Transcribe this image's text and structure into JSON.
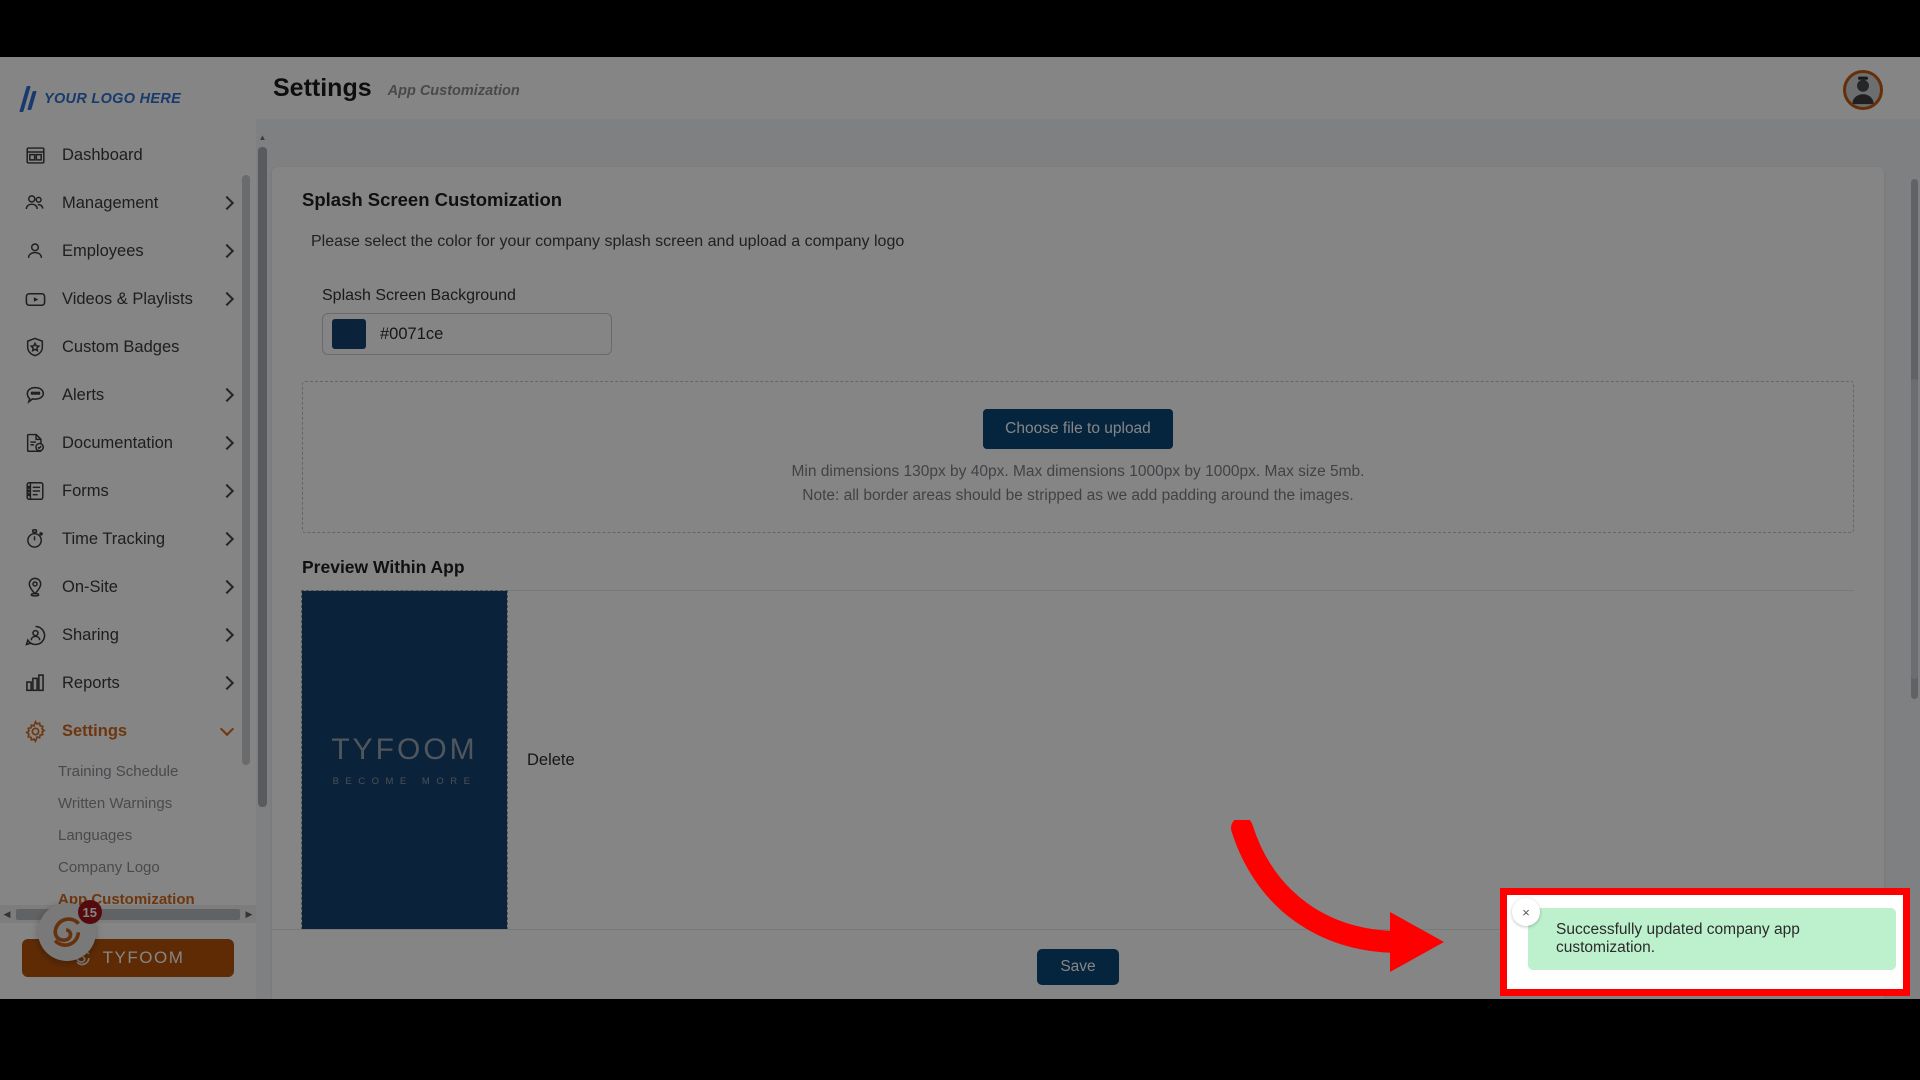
{
  "brand": {
    "logo_text": "YOUR LOGO HERE",
    "accent_color": "#d2691e",
    "primary_color": "#0b4576",
    "logo_blue": "#2f6fd0"
  },
  "sidebar": {
    "items": [
      {
        "label": "Dashboard",
        "icon": "dashboard-icon",
        "has_chevron": false
      },
      {
        "label": "Management",
        "icon": "users-icon",
        "has_chevron": true
      },
      {
        "label": "Employees",
        "icon": "user-icon",
        "has_chevron": true
      },
      {
        "label": "Videos & Playlists",
        "icon": "video-icon",
        "has_chevron": true
      },
      {
        "label": "Custom Badges",
        "icon": "badge-shield-icon",
        "has_chevron": false
      },
      {
        "label": "Alerts",
        "icon": "chat-alert-icon",
        "has_chevron": true
      },
      {
        "label": "Documentation",
        "icon": "document-check-icon",
        "has_chevron": true
      },
      {
        "label": "Forms",
        "icon": "forms-list-icon",
        "has_chevron": true
      },
      {
        "label": "Time Tracking",
        "icon": "stopwatch-icon",
        "has_chevron": true
      },
      {
        "label": "On-Site",
        "icon": "map-pin-icon",
        "has_chevron": true
      },
      {
        "label": "Sharing",
        "icon": "share-person-icon",
        "has_chevron": true
      },
      {
        "label": "Reports",
        "icon": "bar-chart-icon",
        "has_chevron": true
      },
      {
        "label": "Settings",
        "icon": "gear-icon",
        "has_chevron": true,
        "active": true,
        "expanded": true
      }
    ],
    "settings_subitems": [
      {
        "label": "Training Schedule",
        "active": false
      },
      {
        "label": "Written Warnings",
        "active": false
      },
      {
        "label": "Languages",
        "active": false
      },
      {
        "label": "Company Logo",
        "active": false
      },
      {
        "label": "App Customization",
        "active": true
      }
    ],
    "bottom": {
      "widget_label": "TYFOOM",
      "notification_count": "15"
    }
  },
  "topbar": {
    "title": "Settings",
    "breadcrumb": "App Customization"
  },
  "main": {
    "section_title": "Splash Screen Customization",
    "section_subtitle": "Please select the color for your company splash screen and upload a company logo",
    "color_field": {
      "label": "Splash Screen Background",
      "value": "#0071ce",
      "swatch_color": "#14426f"
    },
    "upload": {
      "button_label": "Choose file to upload",
      "hint_line1": "Min dimensions 130px by 40px. Max dimensions 1000px by 1000px. Max size 5mb.",
      "hint_line2": "Note: all border areas should be stripped as we add padding around the images."
    },
    "preview": {
      "title": "Preview Within App",
      "splash_background": "#14426f",
      "logo_wordmark": "TYFOOM",
      "logo_tagline": "BECOME MORE",
      "delete_label": "Delete"
    },
    "footer": {
      "save_label": "Save"
    }
  },
  "toast": {
    "message": "Successfully updated company app customization.",
    "close_label": "×",
    "background": "#bdf0cc",
    "highlight_color": "#ff0000"
  }
}
